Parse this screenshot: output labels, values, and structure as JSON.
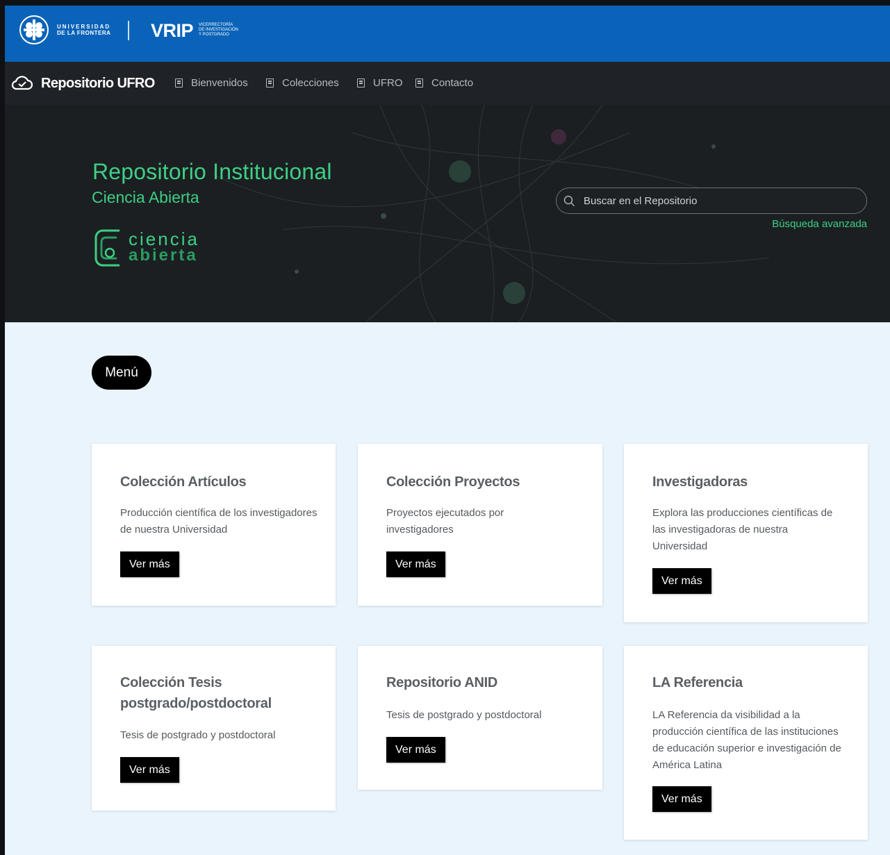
{
  "topbar": {
    "university_line1": "UNIVERSIDAD",
    "university_line2": "DE LA FRONTERA",
    "vrip": "VRIP",
    "vrip_sub1": "VICERRECTORÍA",
    "vrip_sub2": "DE INVESTIGACIÓN",
    "vrip_sub3": "Y POSTGRADO"
  },
  "nav": {
    "brand": "Repositorio UFRO",
    "items": [
      {
        "label": "Bienvenidos",
        "icon": "document-icon"
      },
      {
        "label": "Colecciones",
        "icon": "document-icon"
      },
      {
        "label": "UFRO",
        "icon": "document-icon"
      },
      {
        "label": "Contacto",
        "icon": "document-icon"
      }
    ]
  },
  "hero": {
    "title": "Repositorio Institucional",
    "subtitle": "Ciencia Abierta",
    "logo_line1": "ciencia",
    "logo_line2": "abierta",
    "search_placeholder": "Buscar en el Repositorio",
    "advanced_search": "Búsqueda avanzada"
  },
  "menu_label": "Menú",
  "cards": [
    {
      "title": "Colección Artículos",
      "text": "Producción científica de los investigadores de nuestra Universidad",
      "button": "Ver más"
    },
    {
      "title": "Colección Proyectos",
      "text": "Proyectos ejecutados por investigadores",
      "button": "Ver más"
    },
    {
      "title": "Investigadoras",
      "text": "Explora las producciones científicas de las investigadoras de nuestra Universidad",
      "button": "Ver más"
    },
    {
      "title": "Colección Tesis postgrado/postdoctoral",
      "text": "Tesis de postgrado y postdoctoral",
      "button": "Ver más"
    },
    {
      "title": "Repositorio ANID",
      "text": "Tesis de postgrado y postdoctoral",
      "button": "Ver más"
    },
    {
      "title": "LA Referencia",
      "text": "LA Referencia da visibilidad a la producción científica de las instituciones de educación superior e investigación de América Latina",
      "button": "Ver más"
    }
  ],
  "colors": {
    "topbar": "#0a63b8",
    "nav": "#1f2226",
    "accent_green": "#3fcf84",
    "page_bg": "#eaf4fc"
  }
}
